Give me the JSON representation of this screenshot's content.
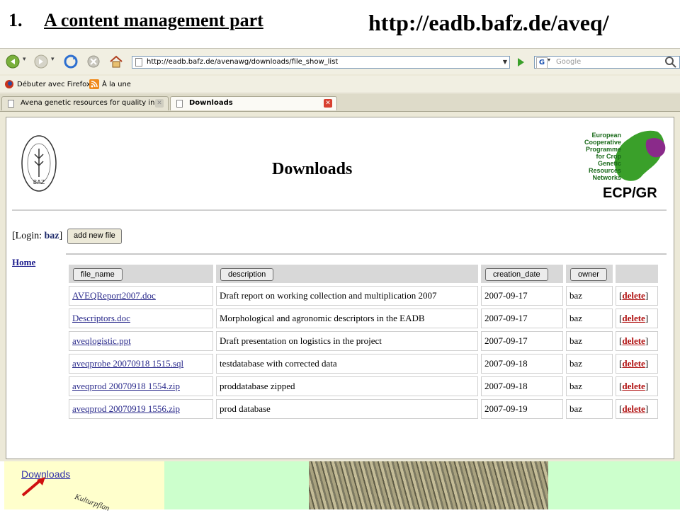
{
  "slide": {
    "number": "1.",
    "title": "A content management part",
    "url": "http://eadb.bafz.de/aveq/"
  },
  "browser": {
    "address": "http://eadb.bafz.de/avenawg/downloads/file_show_list",
    "search_placeholder": "Google",
    "search_logo": "G",
    "bookmarks": [
      {
        "label": "Débuter avec Firefox",
        "icon": "firefox-icon"
      },
      {
        "label": "À la une",
        "icon": "rss-icon"
      }
    ],
    "tabs": [
      {
        "label": "Avena genetic resources for quality in...",
        "active": false
      },
      {
        "label": "Downloads",
        "active": true
      }
    ]
  },
  "page": {
    "baz_logo_text": "BAZ",
    "ecpgr_text": "European Cooperative Programme for Crop Genetic Resources Networks",
    "ecpgr_logo": "ECP/GR",
    "heading": "Downloads",
    "login_prefix": "[Login: ",
    "login_user": "baz",
    "login_suffix": "]",
    "add_button": "add new file",
    "home_link": "Home",
    "columns": [
      "file_name",
      "description",
      "creation_date",
      "owner"
    ],
    "delete_label": "delete",
    "rows": [
      {
        "file_name": "AVEQReport2007.doc",
        "description": "Draft report on working collection and multiplication 2007",
        "creation_date": "2007-09-17",
        "owner": "baz"
      },
      {
        "file_name": "Descriptors.doc",
        "description": "Morphological and agronomic descriptors in the EADB",
        "creation_date": "2007-09-17",
        "owner": "baz"
      },
      {
        "file_name": "aveqlogistic.ppt",
        "description": "Draft presentation on logistics in the project",
        "creation_date": "2007-09-17",
        "owner": "baz"
      },
      {
        "file_name": "aveqprobe 20070918 1515.sql",
        "description": "testdatabase with corrected data",
        "creation_date": "2007-09-18",
        "owner": "baz"
      },
      {
        "file_name": "aveqprod 20070918 1554.zip",
        "description": "proddatabase zipped",
        "creation_date": "2007-09-18",
        "owner": "baz"
      },
      {
        "file_name": "aveqprod 20070919 1556.zip",
        "description": "prod database",
        "creation_date": "2007-09-19",
        "owner": "baz"
      }
    ]
  },
  "strip": {
    "link": "Downloads",
    "kultur_text": "Kulturpflan"
  },
  "colors": {
    "strip_yellow": "#ffffcc",
    "strip_green": "#ccffcc",
    "delete_red": "#b01010",
    "link_blue": "#2b2b8c",
    "ecpgr_green": "#3aa02a",
    "ecpgr_purple": "#8a2a8a"
  }
}
